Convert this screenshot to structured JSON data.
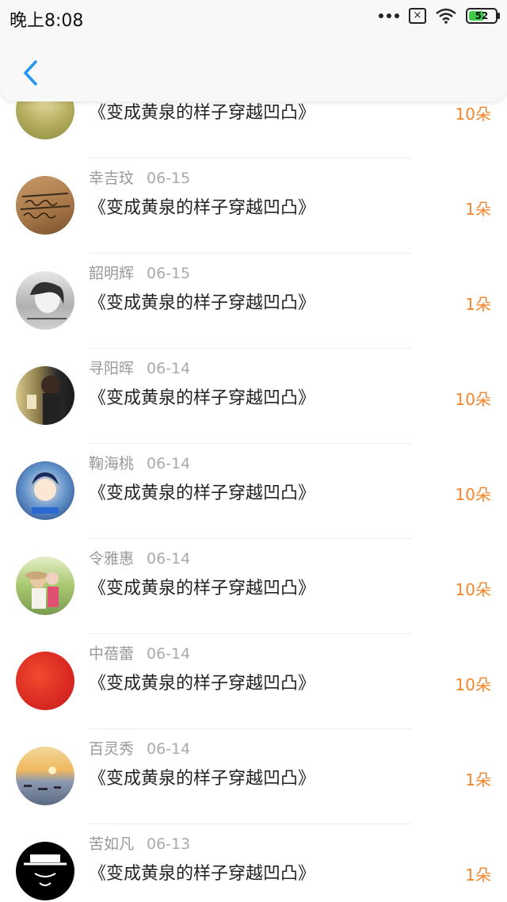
{
  "status_bar": {
    "time": "晚上8:08",
    "battery": "52"
  },
  "header": {
    "back_icon": "back-chevron-icon"
  },
  "list": [
    {
      "name": "",
      "date": "",
      "book": "《变成黄泉的样子穿越凹凸》",
      "count": "10朵",
      "avatar": "green-yellow"
    },
    {
      "name": "幸吉玟",
      "date": "06-15",
      "book": "《变成黄泉的样子穿越凹凸》",
      "count": "1朵",
      "avatar": "brown-handwriting"
    },
    {
      "name": "韶明辉",
      "date": "06-15",
      "book": "《变成黄泉的样子穿越凹凸》",
      "count": "1朵",
      "avatar": "gray-portrait"
    },
    {
      "name": "寻阳晖",
      "date": "06-14",
      "book": "《变成黄泉的样子穿越凹凸》",
      "count": "10朵",
      "avatar": "dark-selfie"
    },
    {
      "name": "鞠海桃",
      "date": "06-14",
      "book": "《变成黄泉的样子穿越凹凸》",
      "count": "10朵",
      "avatar": "blue-anime"
    },
    {
      "name": "令雅惠",
      "date": "06-14",
      "book": "《变成黄泉的样子穿越凹凸》",
      "count": "10朵",
      "avatar": "green-couple"
    },
    {
      "name": "中蓓蕾",
      "date": "06-14",
      "book": "《变成黄泉的样子穿越凹凸》",
      "count": "10朵",
      "avatar": "red-circle"
    },
    {
      "name": "百灵秀",
      "date": "06-14",
      "book": "《变成黄泉的样子穿越凹凸》",
      "count": "1朵",
      "avatar": "sunset-boats"
    },
    {
      "name": "苦如凡",
      "date": "06-13",
      "book": "《变成黄泉的样子穿越凹凸》",
      "count": "1朵",
      "avatar": "black-mask"
    }
  ],
  "colors": {
    "accent": "#f5852b",
    "back": "#2196f3"
  }
}
